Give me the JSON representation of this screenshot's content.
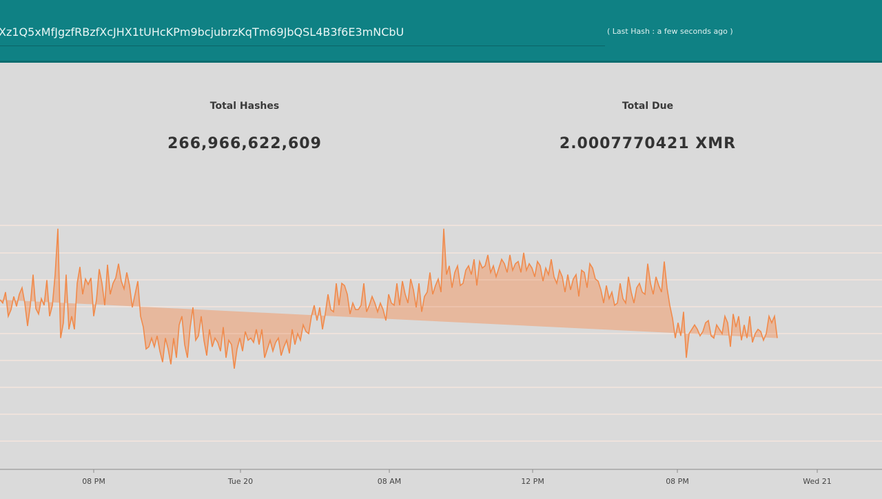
{
  "header": {
    "address": "Xz1Q5xMfJgzfRBzfXcJHX1tUHcKPm9bcjubrzKqTm69JbQSL4B3f6E3mNCbU",
    "last_hash": "( Last Hash : a few seconds ago )"
  },
  "stats": {
    "total_hashes_label": "Total Hashes",
    "total_hashes_value": "266,966,622,609",
    "total_due_label": "Total Due",
    "total_due_value": "2.0007770421 XMR"
  },
  "colors": {
    "header": "#0f8184",
    "line": "#f08a4b",
    "fill": "#e8b496",
    "background": "#dadada"
  },
  "chart_data": {
    "type": "area",
    "grid": true,
    "x_tick_labels": [
      "08 PM",
      "Tue 20",
      "08 AM",
      "12 PM",
      "08 PM",
      "Wed 21"
    ],
    "x": [
      0,
      4,
      8,
      12,
      16,
      20,
      24,
      28,
      32,
      36,
      40,
      44,
      48,
      52,
      56,
      60,
      64,
      68,
      72,
      76,
      80,
      84,
      88,
      92,
      96,
      100,
      104,
      108,
      112,
      116,
      120,
      124,
      128,
      132,
      136,
      140,
      144,
      148,
      152,
      156,
      160,
      164,
      168,
      172,
      176,
      180,
      184,
      188,
      192,
      196,
      200,
      204,
      208,
      212,
      216,
      220,
      224,
      228,
      232,
      236,
      240,
      244,
      248,
      252,
      256,
      260,
      264,
      268,
      272,
      276,
      280,
      284,
      288,
      292,
      296,
      300,
      304,
      308,
      312,
      316,
      320,
      324,
      328,
      332,
      336,
      340,
      344,
      348,
      352,
      356,
      360,
      364,
      368,
      372,
      376,
      380,
      384,
      388,
      392,
      396,
      400,
      404,
      408,
      412,
      416,
      420,
      424,
      428,
      432,
      436,
      440,
      444,
      448,
      452,
      456,
      460,
      464,
      468,
      472,
      476,
      480,
      484,
      488,
      492,
      496,
      500,
      504,
      508,
      512,
      516,
      520,
      524,
      528,
      532,
      536,
      540,
      544,
      548,
      552,
      556,
      560,
      564,
      568,
      572,
      576,
      580,
      584,
      588,
      592,
      596,
      600,
      604,
      608,
      612,
      616,
      620,
      624,
      628,
      632,
      636,
      640,
      644,
      648,
      652,
      656,
      660,
      664,
      668,
      672,
      676,
      680,
      684,
      688,
      692,
      696,
      700,
      704,
      708,
      712,
      716,
      720,
      724,
      728,
      732,
      736,
      740,
      744,
      748,
      752,
      756,
      760,
      764,
      768,
      772,
      776,
      780,
      784,
      788,
      792,
      796,
      800,
      804,
      808,
      812,
      816,
      820,
      824,
      828,
      832,
      836,
      840,
      844,
      848,
      852,
      856,
      860,
      864,
      868,
      872,
      876,
      880,
      884,
      888,
      892,
      896,
      900,
      904,
      908,
      912,
      916,
      920,
      924,
      928,
      932,
      936,
      940,
      944,
      948,
      952,
      956,
      960,
      964,
      968,
      972,
      976,
      980,
      984,
      988,
      992,
      996,
      1000,
      1004,
      1008,
      1012,
      1016,
      1020,
      1024,
      1028,
      1032,
      1036,
      1040,
      1044,
      1048,
      1052,
      1056,
      1060,
      1064,
      1068,
      1072,
      1076,
      1080,
      1084,
      1088,
      1092,
      1096,
      1100,
      1104,
      1108,
      1112,
      1116,
      1120,
      1124,
      1128,
      1132,
      1136,
      1140,
      1144,
      1148,
      1152,
      1156,
      1160,
      1164,
      1168,
      1172,
      1176,
      1180,
      1184,
      1188,
      1192,
      1196,
      1200,
      1204,
      1208,
      1212,
      1216,
      1220,
      1224,
      1228,
      1232,
      1236,
      1240,
      1244,
      1248,
      1252,
      1256,
      1260,
      1264,
      1268,
      1272,
      1276,
      1280
    ],
    "values": [
      455,
      452,
      462,
      440,
      446,
      458,
      449,
      460,
      466,
      452,
      431,
      450,
      478,
      447,
      442,
      456,
      450,
      473,
      440,
      450,
      478,
      520,
      420,
      434,
      478,
      428,
      440,
      428,
      470,
      485,
      460,
      474,
      469,
      475,
      440,
      455,
      483,
      470,
      450,
      487,
      460,
      470,
      475,
      488,
      472,
      465,
      480,
      468,
      448,
      460,
      472,
      440,
      430,
      410,
      412,
      420,
      412,
      422,
      408,
      398,
      420,
      410,
      396,
      420,
      402,
      432,
      440,
      414,
      402,
      430,
      448,
      418,
      422,
      440,
      418,
      404,
      428,
      412,
      420,
      416,
      408,
      430,
      402,
      418,
      414,
      392,
      410,
      420,
      408,
      426,
      418,
      420,
      416,
      428,
      414,
      428,
      402,
      410,
      418,
      408,
      416,
      420,
      404,
      412,
      418,
      406,
      428,
      414,
      424,
      418,
      432,
      426,
      424,
      440,
      450,
      436,
      448,
      428,
      442,
      460,
      446,
      444,
      470,
      450,
      470,
      468,
      460,
      442,
      452,
      446,
      446,
      450,
      470,
      444,
      450,
      458,
      452,
      444,
      452,
      446,
      436,
      460,
      452,
      450,
      470,
      450,
      472,
      460,
      452,
      474,
      464,
      448,
      470,
      444,
      458,
      462,
      480,
      460,
      468,
      474,
      462,
      520,
      478,
      486,
      466,
      480,
      486,
      468,
      470,
      482,
      486,
      478,
      492,
      468,
      490,
      484,
      486,
      496,
      480,
      486,
      476,
      484,
      492,
      488,
      480,
      496,
      482,
      488,
      490,
      480,
      498,
      482,
      488,
      484,
      476,
      490,
      486,
      472,
      484,
      478,
      492,
      476,
      470,
      482,
      476,
      462,
      478,
      464,
      474,
      478,
      458,
      482,
      480,
      466,
      488,
      484,
      474,
      472,
      464,
      452,
      468,
      456,
      462,
      450,
      452,
      470,
      456,
      452,
      476,
      462,
      452,
      466,
      470,
      462,
      460,
      488,
      470,
      460,
      476,
      468,
      462,
      490,
      466,
      450,
      438,
      420,
      434,
      422,
      444,
      402,
      424,
      428,
      432,
      428,
      422,
      426,
      434,
      436,
      422,
      420,
      432,
      428,
      424,
      440,
      434,
      412,
      442,
      430,
      440,
      418,
      432,
      420,
      440,
      416,
      424,
      428,
      426,
      418,
      424,
      440,
      434,
      440,
      420
    ],
    "yaxis_inverted_note": "",
    "ylim": [
      300,
      540
    ]
  }
}
